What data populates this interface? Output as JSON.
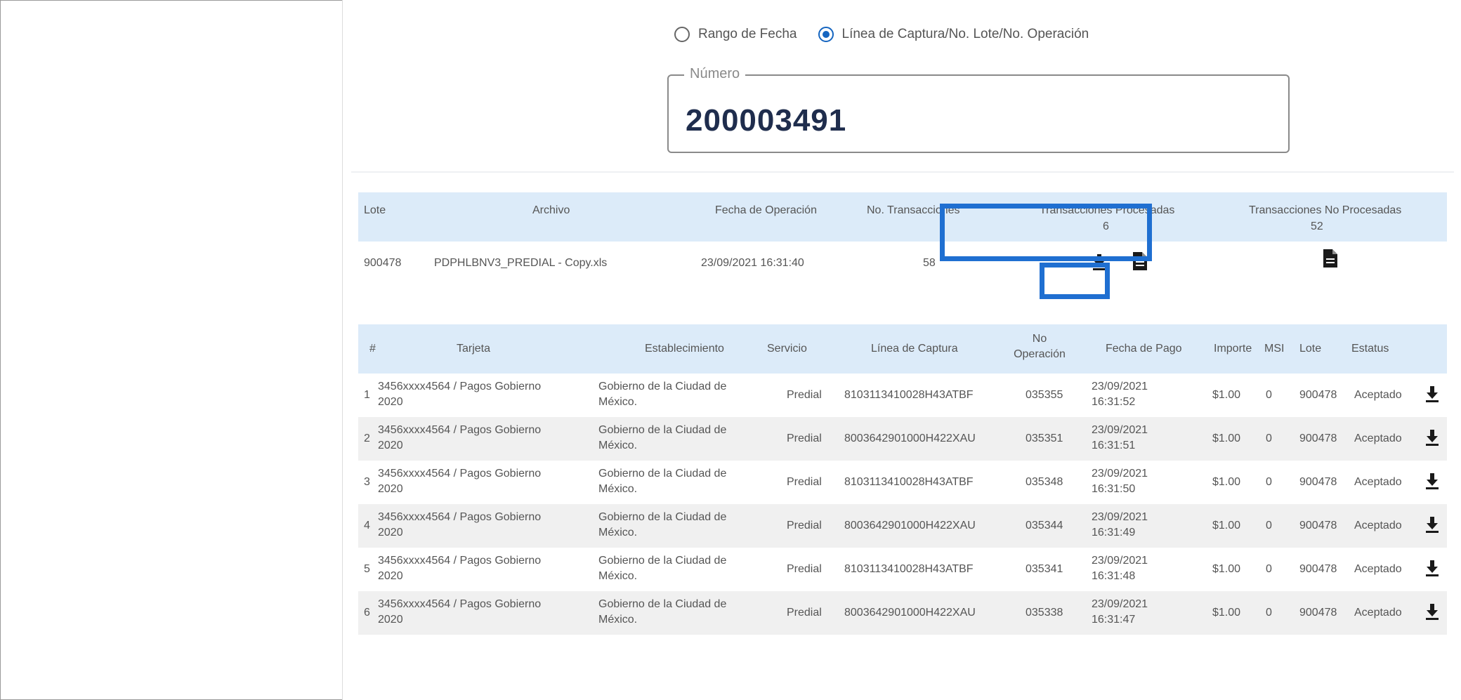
{
  "search": {
    "radio_date": "Rango de Fecha",
    "radio_capture": "Línea de Captura/No. Lote/No. Operación",
    "selected": "capture",
    "field_label": "Número",
    "field_value": "200003491"
  },
  "lote_table": {
    "headers": {
      "lote": "Lote",
      "archivo": "Archivo",
      "fecha": "Fecha de Operación",
      "no_trans": "No. Transacciones",
      "procesadas": "Transacciones Procesadas",
      "procesadas_count": "6",
      "no_procesadas": "Transacciones No Procesadas",
      "no_procesadas_count": "52"
    },
    "row": {
      "lote": "900478",
      "archivo": "PDPHLBNV3_PREDIAL - Copy.xls",
      "fecha": "23/09/2021 16:31:40",
      "no_trans": "58"
    }
  },
  "detail_table": {
    "headers": {
      "num": "#",
      "tarjeta": "Tarjeta",
      "establecimiento": "Establecimiento",
      "servicio": "Servicio",
      "linea": "Línea de Captura",
      "operacion": "No Operación",
      "fecha_pago": "Fecha de Pago",
      "importe": "Importe",
      "msi": "MSI",
      "lote": "Lote",
      "estatus": "Estatus"
    },
    "rows": [
      {
        "num": "1",
        "tarjeta": "3456xxxx4564 / Pagos Gobierno 2020",
        "establecimiento": "Gobierno de la Ciudad de México.",
        "servicio": "Predial",
        "linea": "8103113410028H43ATBF",
        "operacion": "035355",
        "fecha": "23/09/2021 16:31:52",
        "importe": "$1.00",
        "msi": "0",
        "lote": "900478",
        "estatus": "Aceptado"
      },
      {
        "num": "2",
        "tarjeta": "3456xxxx4564 / Pagos Gobierno 2020",
        "establecimiento": "Gobierno de la Ciudad de México.",
        "servicio": "Predial",
        "linea": "8003642901000H422XAU",
        "operacion": "035351",
        "fecha": "23/09/2021 16:31:51",
        "importe": "$1.00",
        "msi": "0",
        "lote": "900478",
        "estatus": "Aceptado"
      },
      {
        "num": "3",
        "tarjeta": "3456xxxx4564 / Pagos Gobierno 2020",
        "establecimiento": "Gobierno de la Ciudad de México.",
        "servicio": "Predial",
        "linea": "8103113410028H43ATBF",
        "operacion": "035348",
        "fecha": "23/09/2021 16:31:50",
        "importe": "$1.00",
        "msi": "0",
        "lote": "900478",
        "estatus": "Aceptado"
      },
      {
        "num": "4",
        "tarjeta": "3456xxxx4564 / Pagos Gobierno 2020",
        "establecimiento": "Gobierno de la Ciudad de México.",
        "servicio": "Predial",
        "linea": "8003642901000H422XAU",
        "operacion": "035344",
        "fecha": "23/09/2021 16:31:49",
        "importe": "$1.00",
        "msi": "0",
        "lote": "900478",
        "estatus": "Aceptado"
      },
      {
        "num": "5",
        "tarjeta": "3456xxxx4564 / Pagos Gobierno 2020",
        "establecimiento": "Gobierno de la Ciudad de México.",
        "servicio": "Predial",
        "linea": "8103113410028H43ATBF",
        "operacion": "035341",
        "fecha": "23/09/2021 16:31:48",
        "importe": "$1.00",
        "msi": "0",
        "lote": "900478",
        "estatus": "Aceptado"
      },
      {
        "num": "6",
        "tarjeta": "3456xxxx4564 / Pagos Gobierno 2020",
        "establecimiento": "Gobierno de la Ciudad de México.",
        "servicio": "Predial",
        "linea": "8003642901000H422XAU",
        "operacion": "035338",
        "fecha": "23/09/2021 16:31:47",
        "importe": "$1.00",
        "msi": "0",
        "lote": "900478",
        "estatus": "Aceptado"
      }
    ]
  },
  "colors": {
    "header_bg": "#dcebf9",
    "accent": "#1565c0",
    "highlight": "#1f6fd1",
    "icon": "#1a1a1a"
  }
}
